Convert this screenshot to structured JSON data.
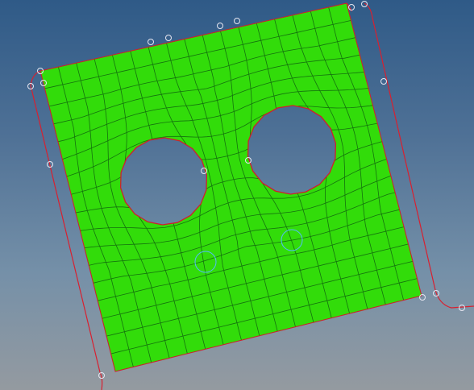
{
  "app": {
    "view_name": ""
  },
  "model": {
    "plate": {
      "fill_color": "#32dc0a",
      "mesh_line_color": "#106010",
      "edge_color": "#d0202a"
    },
    "holes": {
      "count": 2
    },
    "outline_color": "#d82030",
    "node_marker_color": "#e6e6f0",
    "circle_marker_color": "#55b9ff"
  },
  "icons": [
    "node-marker-icon",
    "circle-marker-icon"
  ]
}
